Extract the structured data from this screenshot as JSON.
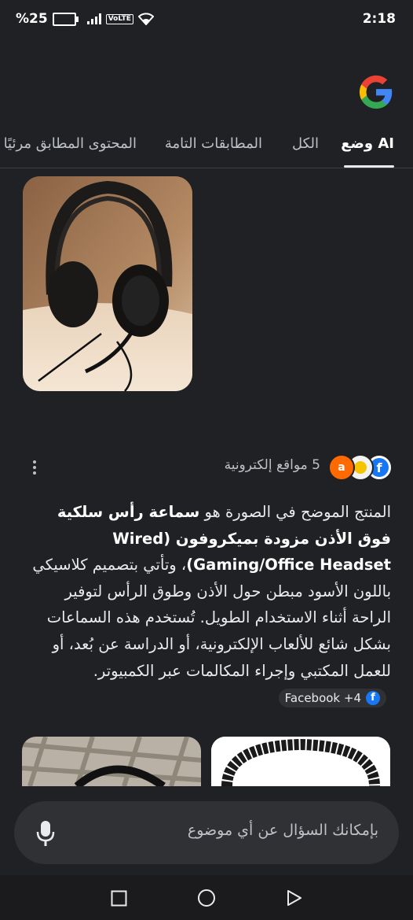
{
  "status_bar": {
    "battery": "%25",
    "volte": "VoLTE",
    "time": "2:18"
  },
  "tabs": [
    {
      "label": "وضع AI",
      "active": true
    },
    {
      "label": "الكل",
      "active": false
    },
    {
      "label": "المطابقات التامة",
      "active": false
    },
    {
      "label": "المحتوى المطابق مرئيًا",
      "active": false
    }
  ],
  "sources": {
    "label": "5 مواقع إلكترونية",
    "icons": [
      "facebook-icon",
      "site-icon-yellow",
      "alibaba-icon"
    ]
  },
  "answer": {
    "part1": "المنتج الموضح في الصورة هو ",
    "bold": "سماعة رأس سلكية فوق الأذن مزودة بميكروفون (Wired Gaming/Office Headset)",
    "part2": "، وتأتي بتصميم كلاسيكي باللون الأسود مبطن حول الأذن وطوق الرأس لتوفير الراحة أثناء الاستخدام الطويل. تُستخدم هذه السماعات بشكل شائع للألعاب الإلكترونية، أو الدراسة عن بُعد، أو للعمل المكتبي وإجراء المكالمات عبر الكمبيوتر.",
    "chip_label": "Facebook +4"
  },
  "search": {
    "placeholder": "بإمكانك السؤال عن أي موضوع"
  },
  "colors": {
    "background": "#202124",
    "facebook": "#1877f2",
    "alibaba": "#ff6a00"
  }
}
